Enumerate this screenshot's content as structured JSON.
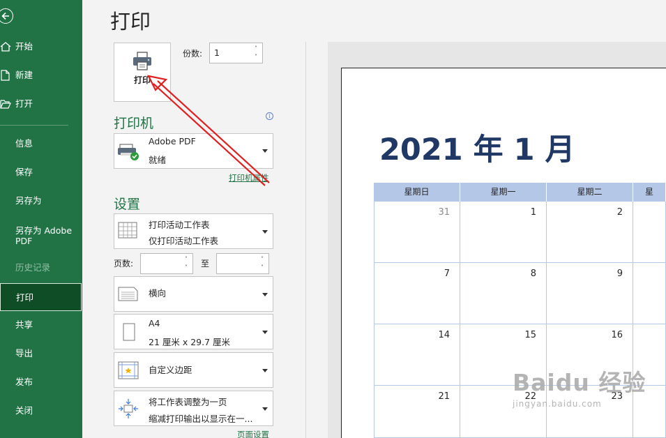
{
  "colors": {
    "brand": "#217346",
    "selected_bg": "#0e4d26",
    "calendar_header": "#b4c7e7",
    "calendar_title": "#1f3864",
    "annotation": "#e02020"
  },
  "sidebar": {
    "back_icon": "arrow-left-circle-icon",
    "items": [
      {
        "label": "开始",
        "icon": "home-icon"
      },
      {
        "label": "新建",
        "icon": "new-file-icon"
      },
      {
        "label": "打开",
        "icon": "folder-open-icon"
      },
      {
        "label": "信息"
      },
      {
        "label": "保存"
      },
      {
        "label": "另存为"
      },
      {
        "label": "另存为 Adobe PDF"
      },
      {
        "label": "历史记录",
        "disabled": true
      },
      {
        "label": "打印",
        "selected": true
      },
      {
        "label": "共享"
      },
      {
        "label": "导出"
      },
      {
        "label": "发布"
      },
      {
        "label": "关闭"
      }
    ]
  },
  "page_title": "打印",
  "print_button": {
    "label": "打印",
    "icon": "printer-icon"
  },
  "copies": {
    "label": "份数:",
    "value": "1"
  },
  "printer": {
    "section_title": "打印机",
    "name": "Adobe PDF",
    "status": "就绪",
    "properties_link": "打印机属性",
    "info_icon": "info-icon"
  },
  "settings": {
    "section_title": "设置",
    "scope": {
      "line1": "打印活动工作表",
      "line2": "仅打印活动工作表"
    },
    "pages": {
      "label": "页数:",
      "to_label": "至",
      "from_value": "",
      "to_value": ""
    },
    "orientation": {
      "line1": "横向"
    },
    "paper": {
      "line1": "A4",
      "line2": "21 厘米 x 29.7 厘米"
    },
    "margins": {
      "line1": "自定义边距"
    },
    "scaling": {
      "line1": "将工作表调整为一页",
      "line2": "缩减打印输出以显示在一..."
    },
    "page_setup_link": "页面设置"
  },
  "preview": {
    "title": "2021 年 1 月",
    "headers": [
      "星期日",
      "星期一",
      "星期二",
      "星"
    ],
    "rows": [
      [
        {
          "n": "31",
          "muted": true
        },
        {
          "n": "1"
        },
        {
          "n": "2"
        },
        {
          "n": ""
        }
      ],
      [
        {
          "n": "7"
        },
        {
          "n": "8"
        },
        {
          "n": "9"
        },
        {
          "n": ""
        }
      ],
      [
        {
          "n": "14"
        },
        {
          "n": "15"
        },
        {
          "n": "16"
        },
        {
          "n": ""
        }
      ],
      [
        {
          "n": "21"
        },
        {
          "n": "22"
        },
        {
          "n": "23"
        },
        {
          "n": ""
        }
      ]
    ]
  },
  "watermark": {
    "main": "Baidu 经验",
    "sub": "jingyan.baidu.com"
  }
}
